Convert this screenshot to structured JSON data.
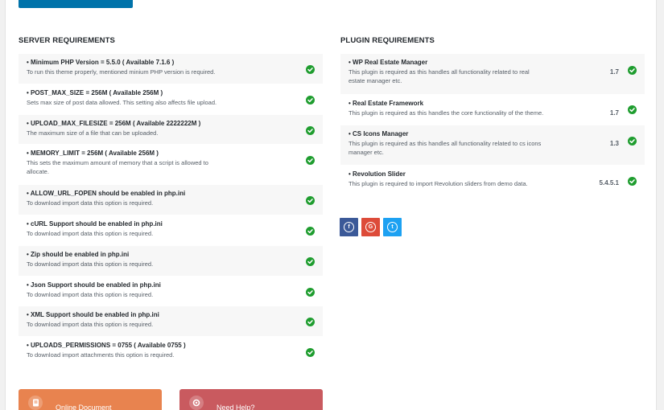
{
  "server": {
    "title": "SERVER REQUIREMENTS",
    "items": [
      {
        "title": "• Minimum PHP Version = 5.5.0 ( Available 7.1.6 )",
        "desc": "To run this theme properly, mentioned minium PHP version is required."
      },
      {
        "title": "• POST_MAX_SIZE = 256M ( Available 256M )",
        "desc": "Sets max size of post data allowed. This setting also affects file upload."
      },
      {
        "title": "• UPLOAD_MAX_FILESIZE = 256M ( Available 2222222M )",
        "desc": "The maximum size of a file that can be uploaded."
      },
      {
        "title": "• MEMORY_LIMIT = 256M ( Available 256M )",
        "desc": "This sets the maximum amount of memory that a script is allowed to",
        "desc2": "allocate."
      },
      {
        "title": "• ALLOW_URL_FOPEN should be enabled in php.ini",
        "desc": "To download import data this option is required."
      },
      {
        "title": "• cURL Support should be enabled in php.ini",
        "desc": "To download import data this option is required."
      },
      {
        "title": "• Zip should be enabled in php.ini",
        "desc": "To download import data this option is required."
      },
      {
        "title": "• Json Support should be enabled in php.ini",
        "desc": "To download import data this option is required."
      },
      {
        "title": "• XML Support should be enabled in php.ini",
        "desc": "To download import data this option is required."
      },
      {
        "title": "• UPLOADS_PERMISSIONS = 0755 ( Available 0755 )",
        "desc": "To download import attachments this option is required."
      }
    ]
  },
  "plugins": {
    "title": "PLUGIN REQUIREMENTS",
    "items": [
      {
        "title": "• WP Real Estate Manager",
        "desc": "This plugin is required as this handles all functionality related to real",
        "desc2": "estate manager etc.",
        "version": "1.7"
      },
      {
        "title": "• Real Estate Framework",
        "desc": "This plugin is required as this handles the core functionality of the theme.",
        "version": "1.7"
      },
      {
        "title": "• CS Icons Manager",
        "desc": "This plugin is required as this handles all functionality related to cs icons",
        "desc2": "manager etc.",
        "version": "1.3"
      },
      {
        "title": "• Revolution Slider",
        "desc": "This plugin is required to import Revolution sliders from demo data.",
        "version": "5.4.5.1"
      }
    ]
  },
  "social": [
    {
      "icon": "facebook-icon",
      "glyph": "f",
      "color": "#3b5998"
    },
    {
      "icon": "google-icon",
      "glyph": "G",
      "color": "#dd4b39"
    },
    {
      "icon": "twitter-icon",
      "glyph": "t",
      "color": "#1da1f2"
    }
  ],
  "cards": {
    "docs_label": "Online Document",
    "help_label": "Need Help?",
    "docs_color": "#e8834f",
    "help_color": "#c95a5f"
  },
  "colors": {
    "accent": "#0073aa",
    "success": "#1f9d2f"
  }
}
